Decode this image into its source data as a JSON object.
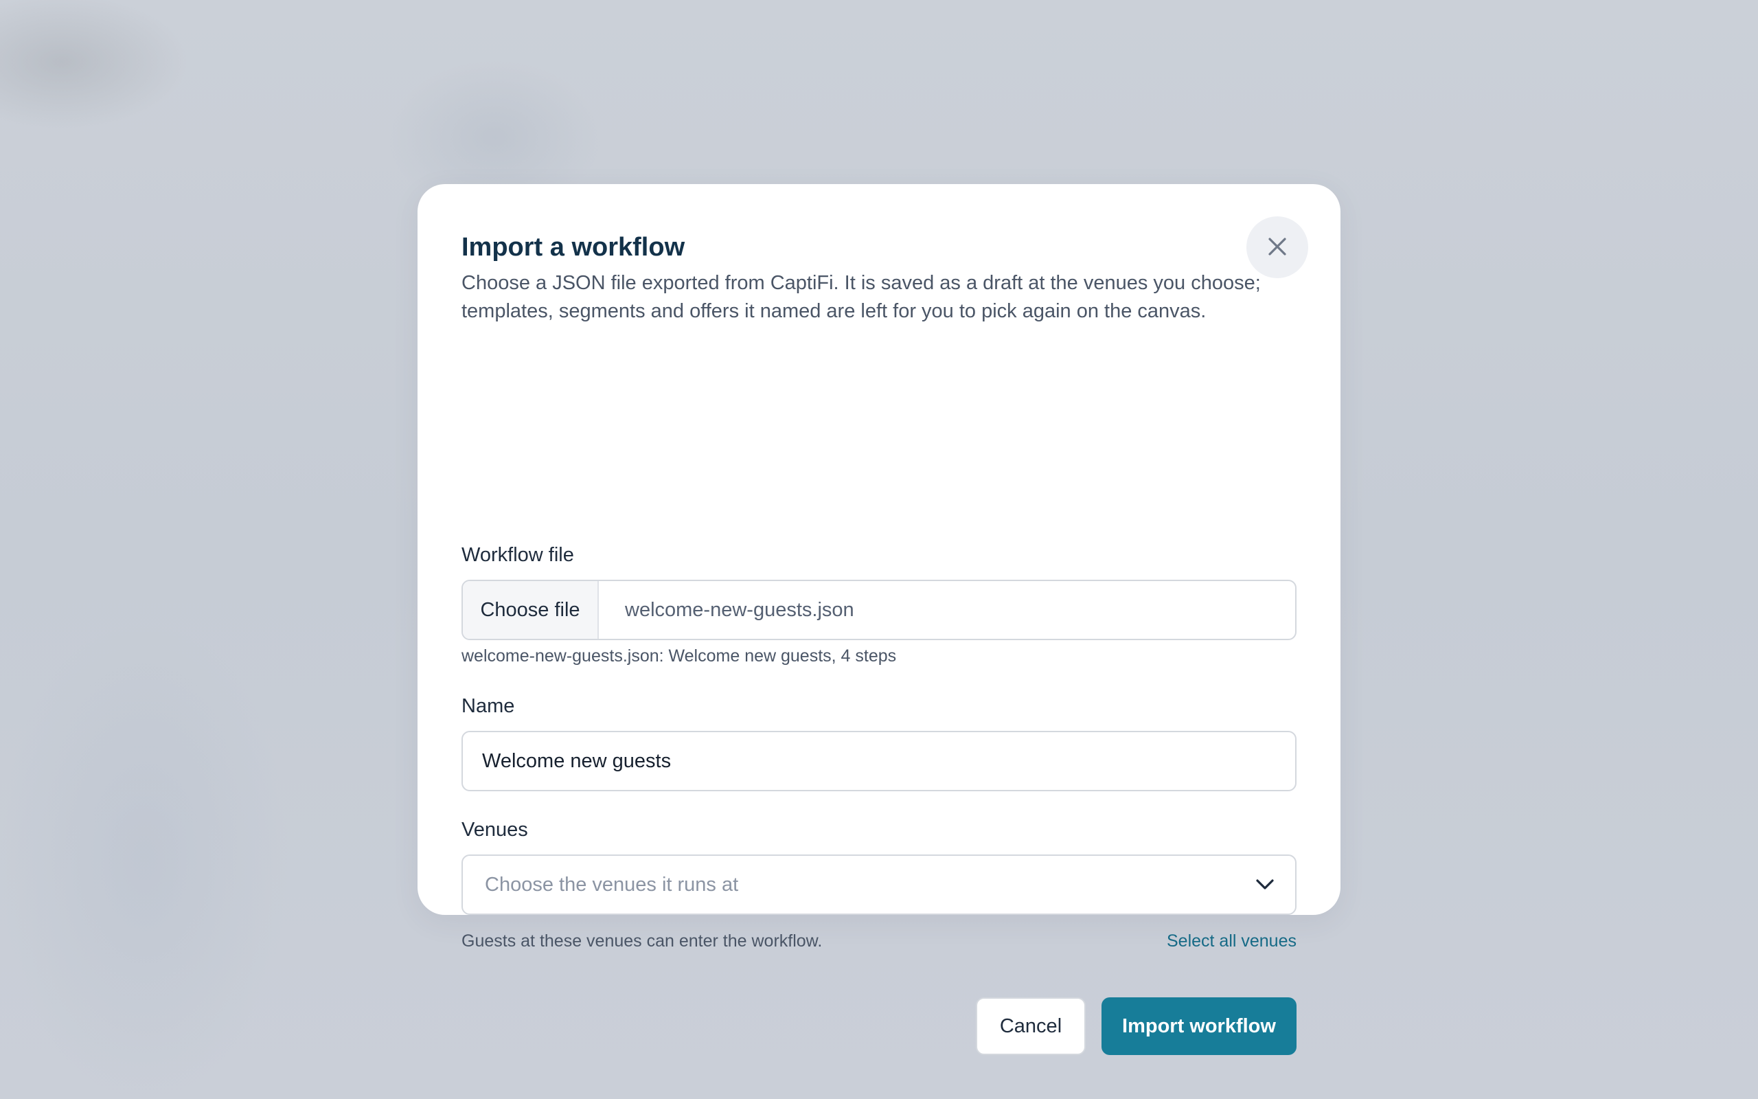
{
  "dialog": {
    "title": "Import a workflow",
    "description": "Choose a JSON file exported from CaptiFi. It is saved as a draft at the venues you choose; templates, segments and offers it named are left for you to pick again on the canvas.",
    "close_icon": "close-icon"
  },
  "workflow_file": {
    "label": "Workflow file",
    "choose_button": "Choose file",
    "file_name": "welcome-new-guests.json",
    "summary": "welcome-new-guests.json: Welcome new guests, 4 steps"
  },
  "name_field": {
    "label": "Name",
    "value": "Welcome new guests"
  },
  "venues": {
    "label": "Venues",
    "placeholder": "Choose the venues it runs at",
    "dropdown_icon": "chevron-down-icon",
    "hint": "Guests at these venues can enter the workflow.",
    "select_all_link": "Select all venues"
  },
  "actions": {
    "cancel_label": "Cancel",
    "import_label": "Import workflow"
  },
  "colors": {
    "primary": "#177d99",
    "link": "#166a86",
    "title": "#13324a"
  }
}
